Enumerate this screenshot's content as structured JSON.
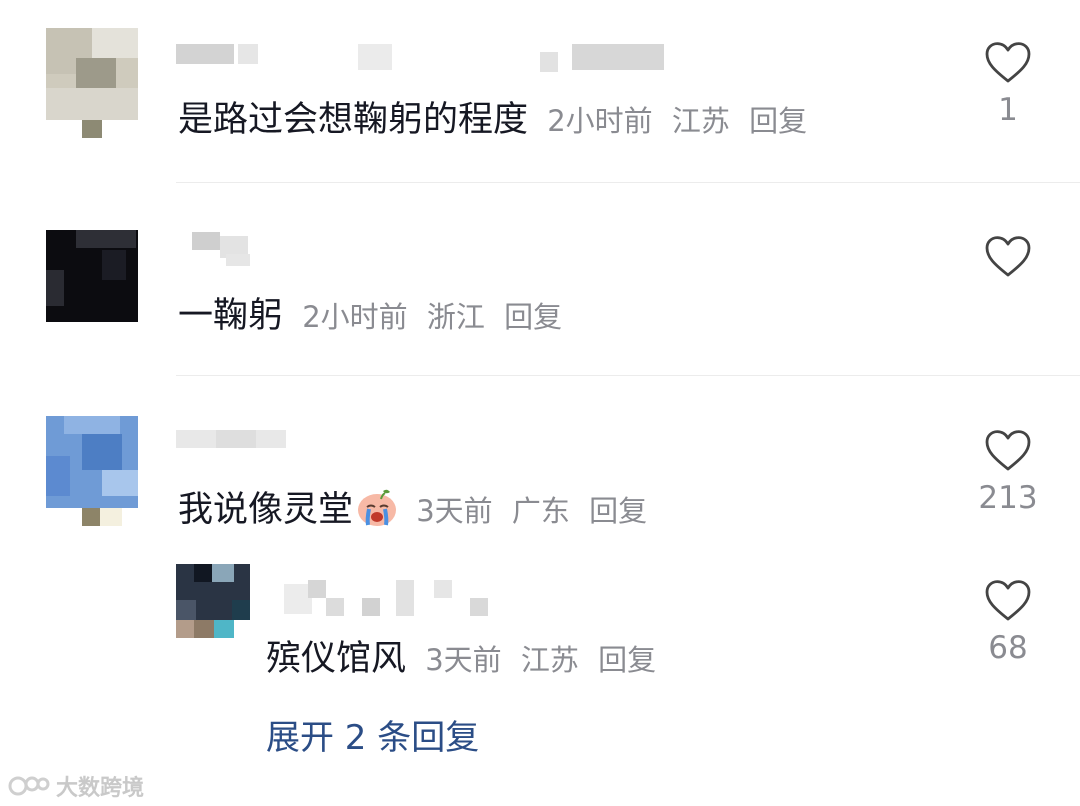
{
  "comments": [
    {
      "text": "是路过会想鞠躬的程度",
      "time": "2小时前",
      "location": "江苏",
      "reply_label": "回复",
      "likes": "1"
    },
    {
      "text": "一鞠躬",
      "time": "2小时前",
      "location": "浙江",
      "reply_label": "回复",
      "likes": ""
    },
    {
      "text": "我说像灵堂",
      "emoji": "crying-face-emoji",
      "time": "3天前",
      "location": "广东",
      "reply_label": "回复",
      "likes": "213",
      "replies": [
        {
          "text": "殡仪馆风",
          "time": "3天前",
          "location": "江苏",
          "reply_label": "回复",
          "likes": "68"
        }
      ],
      "expand_label": "展开 2 条回复"
    }
  ],
  "watermark": "大数跨境",
  "colors": {
    "text": "#161823",
    "meta": "#8a8b91",
    "link": "#2b4d86",
    "divider": "#ececec"
  }
}
